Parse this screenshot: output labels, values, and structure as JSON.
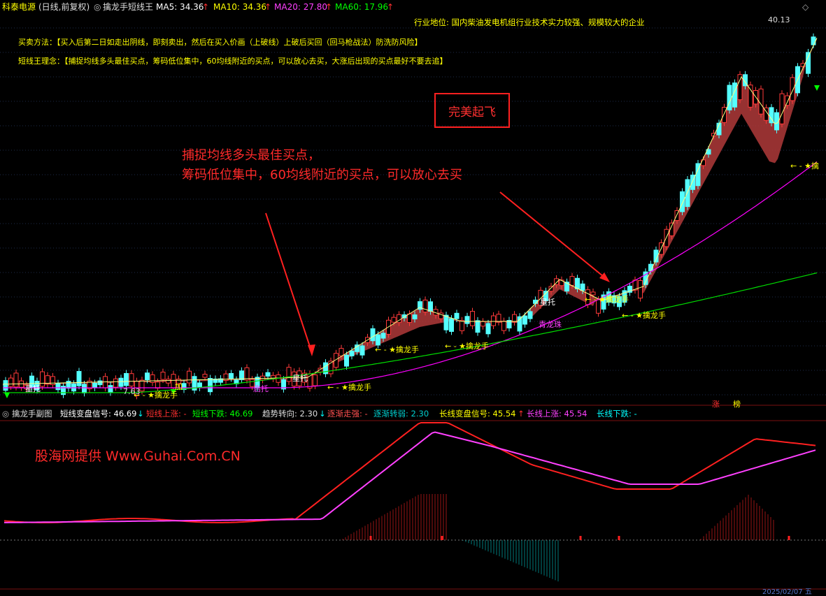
{
  "header": {
    "stock_name": "科泰电源",
    "mode": "(日线,前复权)",
    "indicator_toggle": "◎",
    "indicator_name": "擒龙手短线王",
    "ma5": "MA5: 34.36",
    "ma10": "MA10: 34.36",
    "ma20": "MA20: 27.80",
    "ma60": "MA60: 17.96",
    "arrow_up": "↑",
    "window_control": "◇"
  },
  "info": {
    "industry": "行业地位: 国内柴油发电机组行业技术实力较强、规模较大的企业",
    "method": "买卖方法：【买入后第二日如走出阴线，即刻卖出，然后在买入价画（上破线）上破后买回（回马枪战法）防洗防风险】",
    "philosophy": "短线王理念：【捕捉均线多头最佳买点，筹码低位集中，60均线附近的买点，可以放心去买，大涨后出现的买点最好不要去追】"
  },
  "annotations": {
    "perfect_takeoff": "完美起飞",
    "buy_point_line1": "捕捉均线多头最佳买点，",
    "buy_point_line2": "筹码低位集中，60均线附近的买点，可以放心去买",
    "watermark": "股海网提供 Www.Guhai.Com.CN"
  },
  "main_chart": {
    "high_label": "40.13",
    "low_label": "7.63",
    "signal_labels": [
      {
        "text": "← - ★擒龙手"
      },
      {
        "text": "← - ★擒龙手"
      },
      {
        "text": "← - ★擒龙手"
      },
      {
        "text": "← - ★擒龙手"
      },
      {
        "text": "← - ★擒龙手"
      },
      {
        "text": "← - ★擒龙手"
      },
      {
        "text": "← - ★擒"
      }
    ],
    "misc_labels": {
      "xingtuo_1": "星托",
      "xingtuo_2": "星托",
      "xingtuo_3": "星托",
      "jiaxing": "加",
      "qitui": "启托",
      "zhang": "涨",
      "bang": "榜",
      "dayuzhu": "青龙珠"
    },
    "colors": {
      "up": "#ff3a3a",
      "down": "#54ffff",
      "ma5": "#ffffff",
      "ma20": "#ff00ff",
      "ma60": "#00dd00",
      "band": "#b03a3a"
    }
  },
  "sub_chart": {
    "title": "擒龙手副图",
    "short_signal": "短线变盘信号: 46.69",
    "short_up": "短线上涨: -",
    "short_down": "短线下跌: 46.69",
    "trend_turn": "趋势转向: 2.30",
    "gradually_strong": "逐渐走强: -",
    "gradually_weak": "逐渐转弱: 2.30",
    "long_signal": "长线变盘信号: 45.54",
    "long_up": "长线上涨: 45.54",
    "long_down": "长线下跌: -",
    "colors": {
      "short_up": "#ff2020",
      "short_down": "#00ff00",
      "trend": "#dddddd",
      "strong": "#ff3030",
      "weak": "#00cccc",
      "long_signal": "#ffff00",
      "long_up": "#ff40ff",
      "long_down": "#00ffff"
    }
  },
  "footer": {
    "date_right": "2025/02/07 五"
  }
}
